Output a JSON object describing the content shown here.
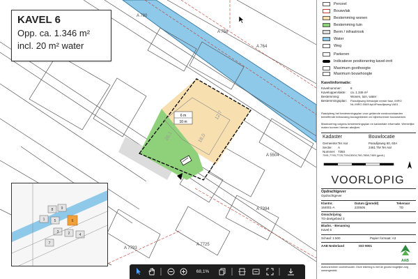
{
  "title_card": {
    "heading": "KAVEL 6",
    "area_line": "Opp. ca. 1.346 m²",
    "water_line": "incl. 20 m² water"
  },
  "map_labels": {
    "a780": "A 780",
    "a758": "A 758",
    "a764": "A 764",
    "a5504": "A 5504",
    "a7394": "A 7394",
    "a7725": "A 7725",
    "a7793": "A 7793",
    "m6": "6 m",
    "m10": "10 m",
    "d127": "12,7",
    "d261": "26,1",
    "d180": "18,0"
  },
  "legend": {
    "items": [
      {
        "label": "Perceel",
        "color": "#ffffff",
        "border": "#555555"
      },
      {
        "label": "Bouwvlak",
        "color": "#ffffff",
        "border": "#c0392b"
      },
      {
        "label": "Bestemming wonen",
        "color": "#f7dfb0",
        "border": "#555555"
      },
      {
        "label": "Bestemming tuin",
        "color": "#8fd17a",
        "border": "#555555"
      },
      {
        "label": "Berm / infrastrook",
        "color": "#dcdcdc",
        "border": "#555555"
      },
      {
        "label": "Water",
        "color": "#8ec9ea",
        "border": "#555555"
      },
      {
        "label": "Weg",
        "color": "#ffffff",
        "border": "#555555"
      },
      {
        "label": "Parkeren",
        "color": "#ffffff",
        "border": "#555555"
      },
      {
        "label": "Indicatieve positionering kavel-inrit",
        "color": "#000000",
        "border": "#000000"
      },
      {
        "label": "Maximum goothoogte",
        "color": "#ffffff",
        "border": "#555555"
      },
      {
        "label": "Maximum bouwhoogte",
        "color": "#ffffff",
        "border": "#555555"
      }
    ]
  },
  "kavelinfo": {
    "heading": "Kavelinformatie:",
    "rows": [
      {
        "k": "Kavelnummer:",
        "v": "6"
      },
      {
        "k": "Kaveloppervlakte:",
        "v": "ca. 1.346 m²"
      },
      {
        "k": "Bestemming:",
        "v": "Wonen, tuin, water"
      },
      {
        "k": "Bestemmingsplan:",
        "v": "Paradijsweg Westzijde eerste fase, IMRO NL.IMRO.0569.bpUiParadijsweg-VA01"
      }
    ],
    "note1": "Raadpleeg het bestemmingsplan voor geldende randvoorwaarden betreffende bebouwing bouwgebieden en bijbehorende bouwwerken.",
    "note2": "Maatvoering volgens bestemmingsplan en kadastrale informatie. Werkelijke maten kunnen hiervan afwijken."
  },
  "kadaster": {
    "h1": "Kadaster",
    "h2": "Bouwlocatie",
    "gemeente_k": "Gemeente:",
    "gemeente_v": "Ter Aar",
    "sectie_k": "Sectie:",
    "sectie_v": "A",
    "nummer_k": "Nummer:",
    "nummer_v": "7393",
    "nummers": "7591,7793,7725,7394,5504,780,7858,7489 (gedl.)",
    "address1": "Paradijsweg 60, 60A",
    "address2": "2461 TM Ter Aar"
  },
  "voorlopig": "VOORLOPIG",
  "titleblock": {
    "opdrachtgever_k": "Opdrachtgever",
    "opdrachtgever_v": "Opdrachtgever",
    "kl_k": "Klantnr.",
    "kl_v": "164001-A",
    "datum_k": "Datum (jjmmdd)",
    "datum_v": "220505",
    "tek_k": "Tekenaar",
    "tek_v": "TD",
    "omschr_k": "Omschrijving",
    "omschr_v": "TO-deelgebied 3",
    "blad_k": "Bladnr. - Benaming",
    "blad_v": "Kavel 6",
    "schaal": "Schaal: 1:500",
    "papier": "Papier formaat: A3",
    "company": "AAB Nederland",
    "iso": "ISO 9001",
    "logo": "AAB",
    "footer": "Auteursrechten voorbehouden. Deze tekening is met de grootst mogelijke zorg samengesteld."
  },
  "toolbar": {
    "zoom": "68,1%"
  },
  "inset": {
    "lots": [
      "8",
      "9",
      "1",
      "5",
      "6",
      "3",
      "2",
      "4",
      "7"
    ]
  }
}
